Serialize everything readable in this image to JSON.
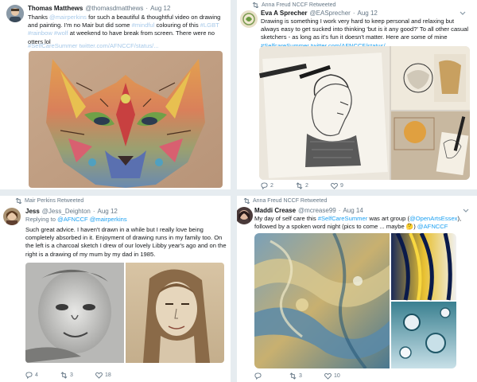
{
  "tweets": [
    {
      "name": "Thomas Matthews",
      "handle": "@thomasdmatthews",
      "date": "Aug 12",
      "dot": "·",
      "text": [
        {
          "t": "Thanks ",
          "c": ""
        },
        {
          "t": "@mairperkins",
          "c": "faint"
        },
        {
          "t": " for such a beautiful & thoughtful video on drawing and painting. I'm no Mair but did some ",
          "c": ""
        },
        {
          "t": "#mindful",
          "c": "faint"
        },
        {
          "t": " colouring of this ",
          "c": ""
        },
        {
          "t": "#LGBT #rainbow #wolf",
          "c": "faint"
        },
        {
          "t": " at weekend to have break from screen. There were no otters lol",
          "c": ""
        }
      ],
      "tags": "#SelfCareSummer twitter.com/AFNCCF/status/..."
    },
    {
      "retweet": "Anna Freud NCCF Retweeted",
      "name": "Eva A Sprecher",
      "handle": "@EASprecher",
      "date": "Aug 12",
      "dot": "·",
      "text": [
        {
          "t": "Drawing is something I work very hard to keep personal and relaxing but always easy to get sucked into thinking 'but is it any good?' To all other casual sketchers - as long as it's fun it doesn't matter. Here are some of mine ",
          "c": ""
        },
        {
          "t": "#SelfcareSummer twitter.com/AFNCCF/status/...",
          "c": "lnk"
        }
      ],
      "actions": {
        "replies": "2",
        "retweets": "2",
        "likes": "9"
      }
    },
    {
      "retweet": "Mair Perkins Retweeted",
      "name": "Jess",
      "handle": "@Jess_Deighton",
      "date": "Aug 12",
      "dot": "·",
      "reply_prefix": "Replying to ",
      "reply_handles": "@AFNCCF @mairperkins",
      "text": [
        {
          "t": "Such great advice. I haven't drawn in a while but I really love being completely absorbed in it. Enjoyment of drawing runs in my family too. On the left is a charcoal sketch I drew of our lovely Libby year's ago and on the right is a drawing of my mum by my dad in 1985.",
          "c": ""
        }
      ],
      "actions": {
        "replies": "4",
        "retweets": "3",
        "likes": "18"
      }
    },
    {
      "retweet": "Anna Freud NCCF Retweeted",
      "name": "Maddi Crease",
      "handle": "@mcrease99",
      "date": "Aug 14",
      "dot": "·",
      "text": [
        {
          "t": "My day of self care this ",
          "c": ""
        },
        {
          "t": "#SelfCareSummer",
          "c": "lnk"
        },
        {
          "t": " was art group (",
          "c": ""
        },
        {
          "t": "@OpenArtsEssex",
          "c": "lnk"
        },
        {
          "t": "), followed by a spoken word night (pics to come ... maybe ",
          "c": ""
        },
        {
          "t": "🤔",
          "c": ""
        },
        {
          "t": ") ",
          "c": ""
        },
        {
          "t": "@AFNCCF",
          "c": "lnk"
        }
      ],
      "actions": {
        "replies": "",
        "retweets": "3",
        "likes": "10"
      }
    }
  ],
  "icons": {
    "retweet": "retweet-icon",
    "reply": "reply-icon",
    "like": "heart-icon",
    "menu": "chevron-down-icon"
  },
  "colors": {
    "link": "#1da1f2",
    "muted": "#657786",
    "background": "#e6ecf0"
  }
}
